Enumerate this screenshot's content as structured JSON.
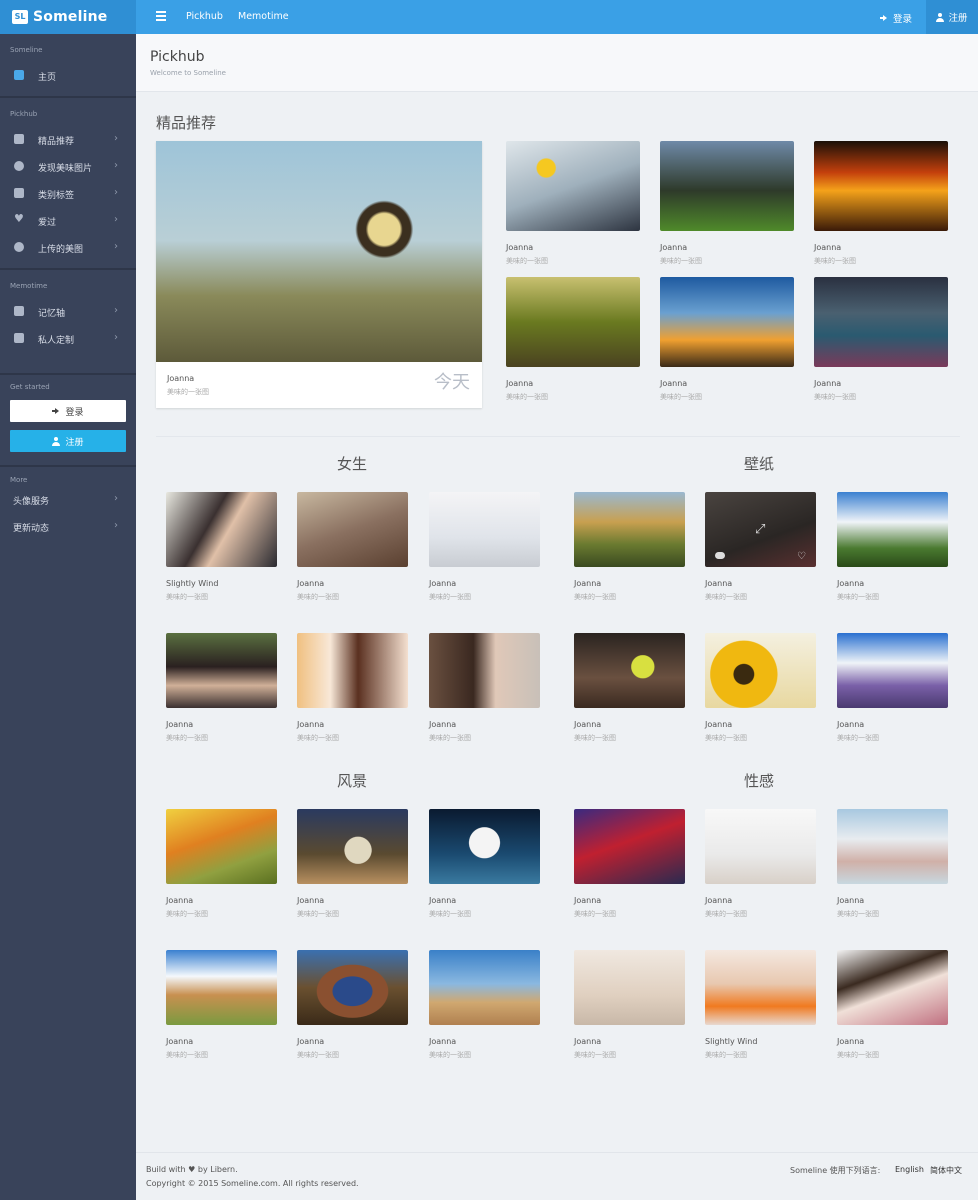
{
  "brand": {
    "logo": "SL",
    "name": "Someline"
  },
  "topnav": {
    "links": [
      "Pickhub",
      "Memotime"
    ],
    "login": "登录",
    "register": "注册"
  },
  "sidebar": {
    "sections": [
      {
        "title": "Someline",
        "items": [
          {
            "label": "主页",
            "icon": "home-icon"
          }
        ]
      },
      {
        "title": "Pickhub",
        "items": [
          {
            "label": "精品推荐",
            "icon": "thumbs-up-icon"
          },
          {
            "label": "发现美味图片",
            "icon": "compass-icon"
          },
          {
            "label": "类别标签",
            "icon": "tags-icon"
          },
          {
            "label": "爱过",
            "icon": "heart-icon"
          },
          {
            "label": "上传的美图",
            "icon": "cloud-upload-icon"
          }
        ]
      },
      {
        "title": "Memotime",
        "items": [
          {
            "label": "记忆轴",
            "icon": "keyboard-icon"
          },
          {
            "label": "私人定制",
            "icon": "wrench-icon"
          }
        ]
      },
      {
        "title": "Get started"
      },
      {
        "title": "More",
        "items": [
          {
            "label": "头像服务"
          },
          {
            "label": "更新动态"
          }
        ]
      }
    ],
    "login_button": "登录",
    "register_button": "注册"
  },
  "header": {
    "title": "Pickhub",
    "subtitle": "Welcome to Someline"
  },
  "featured": {
    "heading": "精品推荐",
    "main": {
      "name": "Joanna",
      "sub": "美味的一张图",
      "badge": "今天"
    },
    "grid": [
      {
        "name": "Joanna",
        "sub": "美味的一张图"
      },
      {
        "name": "Joanna",
        "sub": "美味的一张图"
      },
      {
        "name": "Joanna",
        "sub": "美味的一张图"
      },
      {
        "name": "Joanna",
        "sub": "美味的一张图"
      },
      {
        "name": "Joanna",
        "sub": "美味的一张图"
      },
      {
        "name": "Joanna",
        "sub": "美味的一张图"
      }
    ]
  },
  "categories": [
    {
      "heading": "女生",
      "items": [
        {
          "name": "Slightly Wind",
          "sub": "美味的一张图"
        },
        {
          "name": "Joanna",
          "sub": "美味的一张图"
        },
        {
          "name": "Joanna",
          "sub": "美味的一张图"
        },
        {
          "name": "Joanna",
          "sub": "美味的一张图"
        },
        {
          "name": "Joanna",
          "sub": "美味的一张图"
        },
        {
          "name": "Joanna",
          "sub": "美味的一张图"
        }
      ]
    },
    {
      "heading": "壁纸",
      "items": [
        {
          "name": "Joanna",
          "sub": "美味的一张图"
        },
        {
          "name": "Joanna",
          "sub": "美味的一张图"
        },
        {
          "name": "Joanna",
          "sub": "美味的一张图"
        },
        {
          "name": "Joanna",
          "sub": "美味的一张图"
        },
        {
          "name": "Joanna",
          "sub": "美味的一张图"
        },
        {
          "name": "Joanna",
          "sub": "美味的一张图"
        }
      ]
    },
    {
      "heading": "风景",
      "items": [
        {
          "name": "Joanna",
          "sub": "美味的一张图"
        },
        {
          "name": "Joanna",
          "sub": "美味的一张图"
        },
        {
          "name": "Joanna",
          "sub": "美味的一张图"
        },
        {
          "name": "Joanna",
          "sub": "美味的一张图"
        },
        {
          "name": "Joanna",
          "sub": "美味的一张图"
        },
        {
          "name": "Joanna",
          "sub": "美味的一张图"
        }
      ]
    },
    {
      "heading": "性感",
      "items": [
        {
          "name": "Joanna",
          "sub": "美味的一张图"
        },
        {
          "name": "Joanna",
          "sub": "美味的一张图"
        },
        {
          "name": "Joanna",
          "sub": "美味的一张图"
        },
        {
          "name": "Joanna",
          "sub": "美味的一张图"
        },
        {
          "name": "Slightly Wind",
          "sub": "美味的一张图"
        },
        {
          "name": "Joanna",
          "sub": "美味的一张图"
        }
      ]
    }
  ],
  "footer": {
    "build_prefix": "Build with",
    "heart": "♥",
    "build_suffix": "by Libern.",
    "copyright": "Copyright © 2015 Someline.com.  All rights reserved.",
    "lang_label": "Someline 使用下列语言:",
    "langs": [
      "English",
      "简体中文"
    ]
  }
}
